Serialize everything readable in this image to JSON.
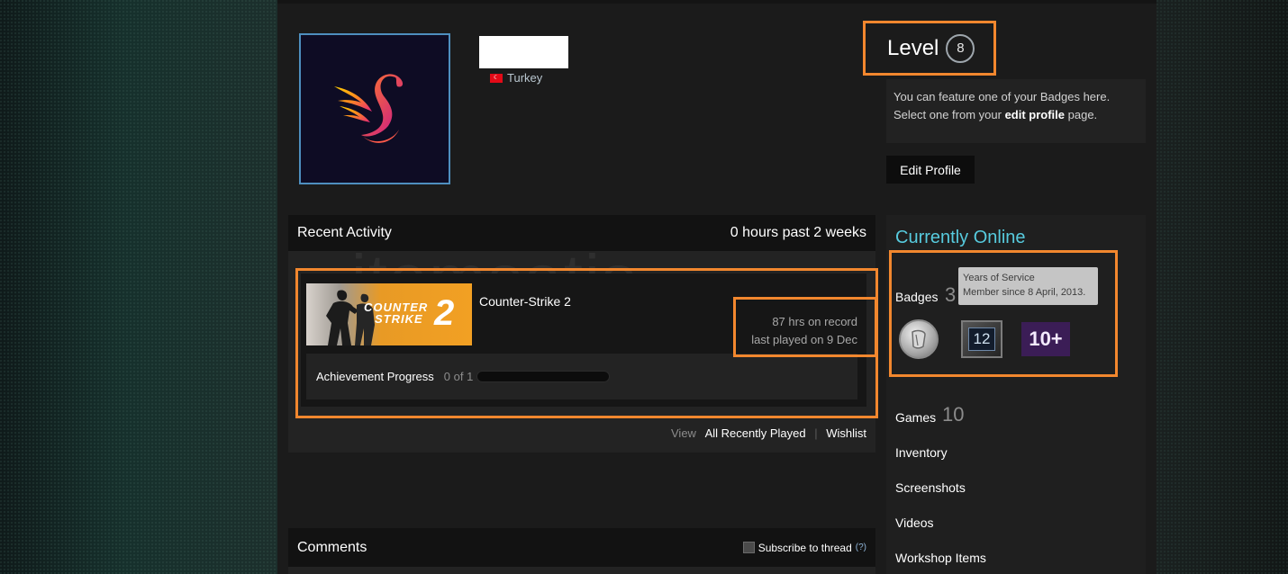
{
  "profile": {
    "country": "Turkey",
    "country_flag_glyph": "☾",
    "level_label": "Level",
    "level": "8",
    "feature_text_1": "You can feature one of your Badges here.",
    "feature_text_2_prefix": "Select one from your ",
    "feature_text_2_link": "edit profile",
    "feature_text_2_suffix": " page.",
    "edit_profile_label": "Edit Profile"
  },
  "recent_activity": {
    "title": "Recent Activity",
    "playtime": "0 hours past 2 weeks",
    "game": {
      "name": "Counter-Strike 2",
      "thumb_logo_line1": "COUNTER",
      "thumb_logo_line2": "STRIKE",
      "thumb_logo_number": "2",
      "hours_on_record": "87 hrs on record",
      "last_played": "last played on 9 Dec",
      "achievement_label": "Achievement Progress",
      "achievement_count": "0 of 1",
      "achievement_progress": 0
    },
    "view_label": "View",
    "all_recently_played": "All Recently Played",
    "wishlist": "Wishlist"
  },
  "comments": {
    "title": "Comments",
    "subscribe_label": "Subscribe to thread",
    "help_label": "(?)"
  },
  "sidebar": {
    "status": "Currently Online",
    "badges_label": "Badges",
    "badges_count": "3",
    "tooltip_title": "Years of Service",
    "tooltip_text": "Member since 8 April, 2013.",
    "badge_12_label": "12",
    "badge_10_label": "10+",
    "games_label": "Games",
    "games_count": "10",
    "inventory_label": "Inventory",
    "screenshots_label": "Screenshots",
    "videos_label": "Videos",
    "workshop_label": "Workshop Items"
  },
  "watermark": "itemsatis",
  "colors": {
    "highlight": "#f2872e",
    "online": "#57cbde",
    "avatar_border": "#4e8fbf"
  }
}
